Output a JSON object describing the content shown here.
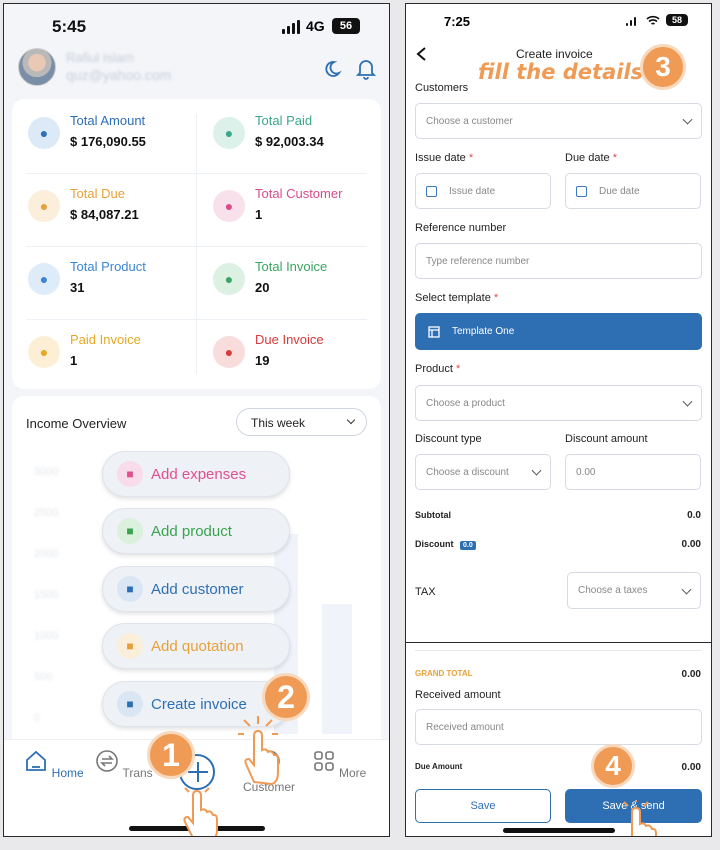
{
  "left": {
    "status_time": "5:45",
    "network": "4G",
    "battery": "56",
    "email_blurred": "quz@yahoo.com",
    "name_blurred": "Rafiul Islam",
    "stats": [
      {
        "label": "Total Amount",
        "value": "$ 176,090.55",
        "color": "#2f6db5",
        "icon": "handshake-icon",
        "icon_bg": "#dce9f7"
      },
      {
        "label": "Total Paid",
        "value": "$ 92,003.34",
        "color": "#3aa88a",
        "icon": "money-hand-icon",
        "icon_bg": "#dcf1ea"
      },
      {
        "label": "Total Due",
        "value": "$ 84,087.21",
        "color": "#e6a13a",
        "icon": "wallet-icon",
        "icon_bg": "#fbeedb"
      },
      {
        "label": "Total Customer",
        "value": "1",
        "color": "#d94b8c",
        "icon": "users-icon",
        "icon_bg": "#f9e1ec"
      },
      {
        "label": "Total Product",
        "value": "31",
        "color": "#3b86d1",
        "icon": "boxes-icon",
        "icon_bg": "#deebf8"
      },
      {
        "label": "Total Invoice",
        "value": "20",
        "color": "#3aa563",
        "icon": "receipt-icon",
        "icon_bg": "#dcf1e2"
      },
      {
        "label": "Paid Invoice",
        "value": "1",
        "color": "#e6a822",
        "icon": "paid-doc-icon",
        "icon_bg": "#fcefd5"
      },
      {
        "label": "Due Invoice",
        "value": "19",
        "color": "#d63b3b",
        "icon": "due-doc-icon",
        "icon_bg": "#f9dcdc"
      }
    ],
    "income_title": "Income Overview",
    "period": "This week",
    "chart_axis_blurred": [
      "3000",
      "2500",
      "2000",
      "1500",
      "1000",
      "500",
      "0"
    ],
    "actions": [
      {
        "label": "Add expenses",
        "color": "#e0508f",
        "icon": "expense-icon",
        "icon_bg": "#f9dce9"
      },
      {
        "label": "Add product",
        "color": "#3aa34f",
        "icon": "product-icon",
        "icon_bg": "#dcf0de"
      },
      {
        "label": "Add customer",
        "color": "#2e6fb4",
        "icon": "customer-icon",
        "icon_bg": "#dae6f3"
      },
      {
        "label": "Add quotation",
        "color": "#e6a13a",
        "icon": "quotation-icon",
        "icon_bg": "#fbeedb"
      },
      {
        "label": "Create invoice",
        "color": "#2e6fb4",
        "icon": "invoice-icon",
        "icon_bg": "#dae6f3"
      }
    ],
    "nav": [
      {
        "label": "Home",
        "icon": "home-icon"
      },
      {
        "label": "Trans",
        "icon": "transfer-icon"
      },
      {
        "label": "Customer",
        "icon": "customer-nav-icon"
      },
      {
        "label": "More",
        "icon": "grid-icon"
      }
    ],
    "badges": [
      "1",
      "2"
    ]
  },
  "right": {
    "status_time": "7:25",
    "battery": "58",
    "page_title": "Create invoice",
    "annotation": "fill the details",
    "badges": [
      "3",
      "4"
    ],
    "customers_label": "Customers",
    "customer_placeholder": "Choose a customer",
    "issue_date_label": "Issue date",
    "issue_date_placeholder": "Issue date",
    "due_date_label": "Due date",
    "due_date_placeholder": "Due date",
    "reference_label": "Reference number",
    "reference_placeholder": "Type reference number",
    "template_label": "Select template",
    "template_value": "Template One",
    "product_label": "Product",
    "product_placeholder": "Choose a product",
    "discount_type_label": "Discount type",
    "discount_type_placeholder": "Choose a discount",
    "discount_amount_label": "Discount amount",
    "discount_amount_placeholder": "0.00",
    "subtotal_label": "Subtotal",
    "subtotal_value": "0.0",
    "discount_label": "Discount",
    "discount_badge": "0.0",
    "discount_value": "0.00",
    "tax_label": "TAX",
    "tax_placeholder": "Choose a taxes",
    "grand_total_label": "GRAND TOTAL",
    "grand_total_value": "0.00",
    "received_label": "Received amount",
    "received_placeholder": "Received amount",
    "due_amount_label": "Due Amount",
    "due_amount_value": "0.00",
    "save_label": "Save",
    "save_send_label": "Save & send",
    "required_mark": "*"
  }
}
